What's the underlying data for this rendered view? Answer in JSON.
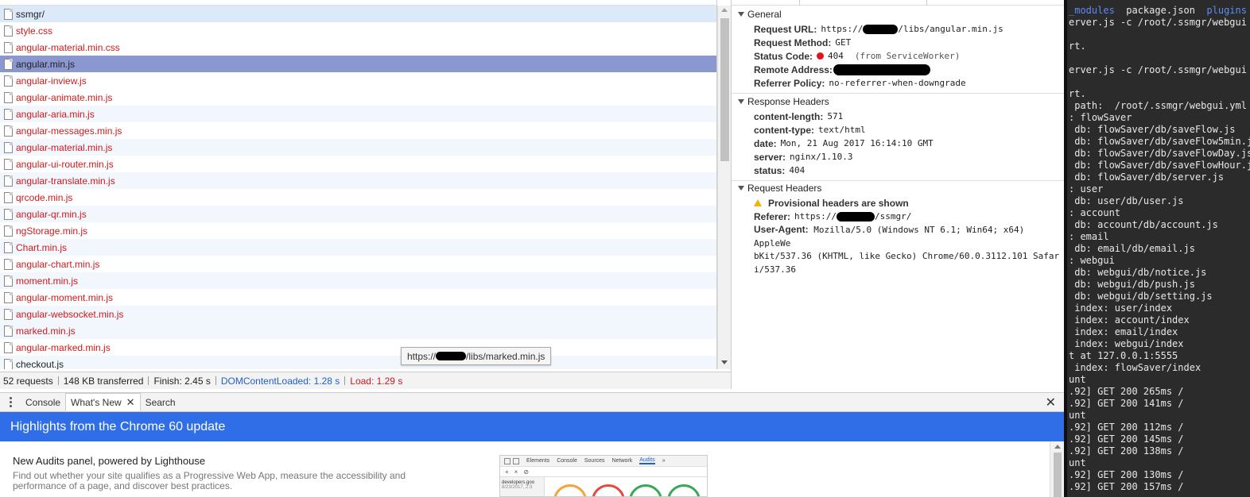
{
  "requests": [
    {
      "name": "ssmgr/",
      "status": "ok",
      "row": "first"
    },
    {
      "name": "style.css",
      "status": "error",
      "row": "odd"
    },
    {
      "name": "angular-material.min.css",
      "status": "error",
      "row": "odd"
    },
    {
      "name": "angular.min.js",
      "status": "ok",
      "row": "selected"
    },
    {
      "name": "angular-inview.js",
      "status": "error",
      "row": "odd"
    },
    {
      "name": "angular-animate.min.js",
      "status": "error",
      "row": "odd"
    },
    {
      "name": "angular-aria.min.js",
      "status": "error",
      "row": "even"
    },
    {
      "name": "angular-messages.min.js",
      "status": "error",
      "row": "odd"
    },
    {
      "name": "angular-material.min.js",
      "status": "error",
      "row": "even"
    },
    {
      "name": "angular-ui-router.min.js",
      "status": "error",
      "row": "odd"
    },
    {
      "name": "angular-translate.min.js",
      "status": "error",
      "row": "even"
    },
    {
      "name": "qrcode.min.js",
      "status": "error",
      "row": "odd"
    },
    {
      "name": "angular-qr.min.js",
      "status": "error",
      "row": "even"
    },
    {
      "name": "ngStorage.min.js",
      "status": "error",
      "row": "odd"
    },
    {
      "name": "Chart.min.js",
      "status": "error",
      "row": "even"
    },
    {
      "name": "angular-chart.min.js",
      "status": "error",
      "row": "odd"
    },
    {
      "name": "moment.min.js",
      "status": "error",
      "row": "even"
    },
    {
      "name": "angular-moment.min.js",
      "status": "error",
      "row": "odd"
    },
    {
      "name": "angular-websocket.min.js",
      "status": "error",
      "row": "even"
    },
    {
      "name": "marked.min.js",
      "status": "error",
      "row": "even"
    },
    {
      "name": "angular-marked.min.js",
      "status": "error",
      "row": "odd"
    },
    {
      "name": "checkout.js",
      "status": "ok",
      "row": "even"
    }
  ],
  "tooltip": {
    "prefix": "https://",
    "suffix": "/libs/marked.min.js"
  },
  "status_bar": {
    "requests": "52 requests",
    "transferred": "148 KB transferred",
    "finish": "Finish: 2.45 s",
    "dcl": "DOMContentLoaded: 1.28 s",
    "load": "Load: 1.29 s"
  },
  "headers": {
    "general": {
      "title": "General",
      "request_url_key": "Request URL:",
      "request_url_prefix": "https://",
      "request_url_suffix": "/libs/angular.min.js",
      "method_key": "Request Method:",
      "method": "GET",
      "status_key": "Status Code:",
      "status_code": "404",
      "status_note": "(from ServiceWorker)",
      "remote_key": "Remote Address:",
      "referrer_key": "Referrer Policy:",
      "referrer": "no-referrer-when-downgrade"
    },
    "response": {
      "title": "Response Headers",
      "items": [
        {
          "k": "content-length:",
          "v": "571"
        },
        {
          "k": "content-type:",
          "v": "text/html"
        },
        {
          "k": "date:",
          "v": "Mon, 21 Aug 2017 16:14:10 GMT"
        },
        {
          "k": "server:",
          "v": "nginx/1.10.3"
        },
        {
          "k": "status:",
          "v": "404"
        }
      ]
    },
    "request": {
      "title": "Request Headers",
      "warning": "Provisional headers are shown",
      "referer_key": "Referer:",
      "referer_prefix": "https://",
      "referer_suffix": "/ssmgr/",
      "ua_key": "User-Agent:",
      "ua_line1": "Mozilla/5.0 (Windows NT 6.1; Win64; x64) AppleWe",
      "ua_line2": "bKit/537.36 (KHTML, like Gecko) Chrome/60.0.3112.101 Safar",
      "ua_line3": "i/537.36"
    }
  },
  "terminal": {
    "header_dir": "_modules",
    "header_file": "package.json",
    "header_dir2": "plugins",
    "lines": [
      "erver.js -c /root/.ssmgr/webgui",
      "",
      "rt.",
      "",
      "erver.js -c /root/.ssmgr/webgui",
      "",
      "rt.",
      " path:  /root/.ssmgr/webgui.yml",
      ": flowSaver",
      " db: flowSaver/db/saveFlow.js",
      " db: flowSaver/db/saveFlow5min.j",
      " db: flowSaver/db/saveFlowDay.js",
      " db: flowSaver/db/saveFlowHour.j",
      " db: flowSaver/db/server.js",
      ": user",
      " db: user/db/user.js",
      ": account",
      " db: account/db/account.js",
      ": email",
      " db: email/db/email.js",
      ": webgui",
      " db: webgui/db/notice.js",
      " db: webgui/db/push.js",
      " db: webgui/db/setting.js",
      " index: user/index",
      " index: account/index",
      " index: email/index",
      " index: webgui/index",
      "t at 127.0.0.1:5555",
      " index: flowSaver/index",
      "unt",
      ".92] GET 200 265ms /",
      ".92] GET 200 141ms /",
      "unt",
      ".92] GET 200 112ms /",
      ".92] GET 200 145ms /",
      ".92] GET 200 138ms /",
      "unt",
      ".92] GET 200 130ms /",
      ".92] GET 200 157ms /"
    ]
  },
  "drawer": {
    "tab_console": "Console",
    "tab_whats_new": "What's New",
    "tab_search": "Search",
    "banner": "Highlights from the Chrome 60 update",
    "item_title": "New Audits panel, powered by Lighthouse",
    "item_desc": "Find out whether your site qualifies as a Progressive Web App, measure the accessibility and performance of a page, and discover best practices.",
    "thumb_tabs": [
      "Elements",
      "Console",
      "Sources",
      "Network",
      "Audits",
      "»"
    ],
    "thumb_active": "Audits",
    "thumb_side1": "developers.goo",
    "thumb_side2": "8/23/2017, 2:3"
  },
  "colors": {
    "error_text": "#d0191b",
    "selected_row": "#8b97cf",
    "banner": "#2f6ee6",
    "status_dot": "#e0141a",
    "terminal_bg": "#2b2b2b",
    "dir_blue": "#5a8df7"
  }
}
